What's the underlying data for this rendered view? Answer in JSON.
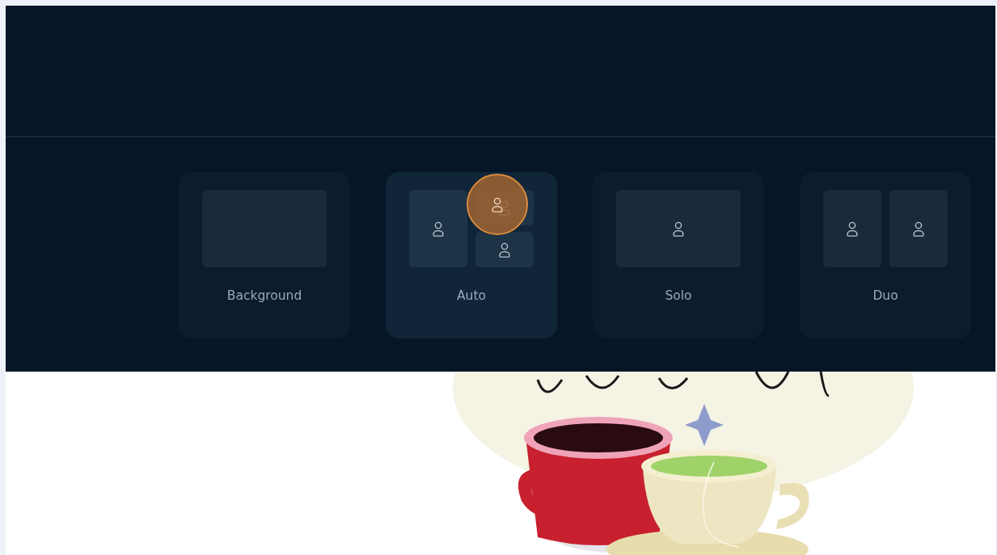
{
  "layouts": [
    {
      "label": "Background",
      "kind": "background",
      "selected": false,
      "highlighted": false
    },
    {
      "label": "Auto",
      "kind": "auto",
      "selected": true,
      "highlighted": true
    },
    {
      "label": "Solo",
      "kind": "solo",
      "selected": false,
      "highlighted": false
    },
    {
      "label": "Duo",
      "kind": "duo",
      "selected": false,
      "highlighted": false
    }
  ]
}
